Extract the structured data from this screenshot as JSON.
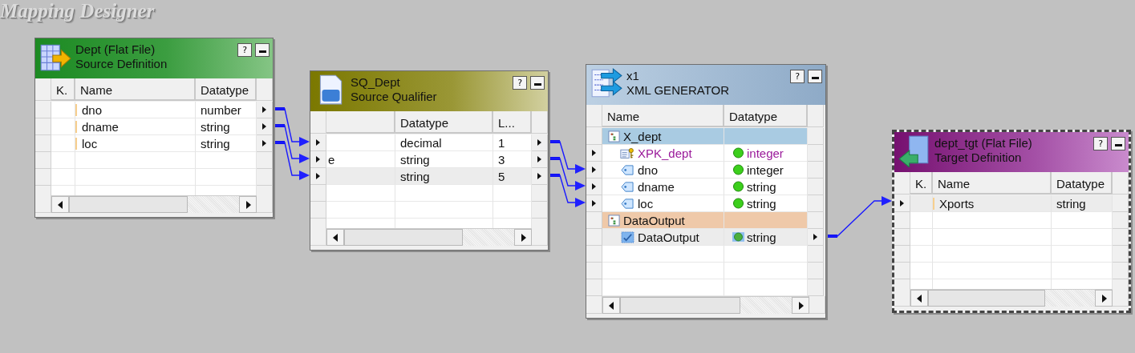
{
  "title": "Mapping Designer",
  "nodes": [
    {
      "kind": "source",
      "name": "Dept (Flat File)",
      "type": "Source Definition",
      "help": "?",
      "selected": false,
      "columns": [
        "K.",
        "Name",
        "Datatype"
      ],
      "rows": [
        {
          "kind": "column",
          "cells": [
            null,
            "dno",
            "number"
          ],
          "in": false,
          "out": true,
          "selected": false
        },
        {
          "kind": "column",
          "cells": [
            null,
            "dname",
            "string"
          ],
          "in": false,
          "out": true,
          "selected": false
        },
        {
          "kind": "column",
          "cells": [
            null,
            "loc",
            "string"
          ],
          "in": false,
          "out": true,
          "selected": false
        }
      ]
    },
    {
      "kind": "qualifier",
      "name": "SQ_Dept",
      "type": "Source Qualifier",
      "help": "?",
      "selected": false,
      "columns": [
        null,
        "Datatype",
        "L..."
      ],
      "rows": [
        {
          "kind": "column",
          "cells": [
            null,
            "decimal",
            "1"
          ],
          "in": true,
          "out": true,
          "selected": false
        },
        {
          "kind": "column",
          "cells": [
            "e",
            "string",
            "3"
          ],
          "in": true,
          "out": true,
          "selected": false
        },
        {
          "kind": "column",
          "cells": [
            null,
            "string",
            "5"
          ],
          "in": true,
          "out": true,
          "selected": true
        }
      ]
    },
    {
      "kind": "xml",
      "name": "x1",
      "type": "XML GENERATOR",
      "help": "?",
      "selected": false,
      "columns": [
        "Name",
        "Datatype"
      ],
      "rows": [
        {
          "kind": "group",
          "cells": [
            "X_dept",
            null
          ],
          "color": "#a9cbe2",
          "in": false,
          "out": false,
          "selected": false
        },
        {
          "kind": "key",
          "cells": [
            "XPK_dept",
            "integer"
          ],
          "in": true,
          "out": false,
          "selected": false
        },
        {
          "kind": "field",
          "cells": [
            "dno",
            "integer"
          ],
          "in": true,
          "out": false,
          "selected": false
        },
        {
          "kind": "field",
          "cells": [
            "dname",
            "string"
          ],
          "in": true,
          "out": false,
          "selected": false
        },
        {
          "kind": "field",
          "cells": [
            "loc",
            "string"
          ],
          "in": true,
          "out": false,
          "selected": false
        },
        {
          "kind": "group",
          "cells": [
            "DataOutput",
            null
          ],
          "color": "#efc9a9",
          "in": false,
          "out": false,
          "selected": false
        },
        {
          "kind": "output",
          "cells": [
            "DataOutput",
            "string"
          ],
          "in": false,
          "out": true,
          "selected": true
        }
      ]
    },
    {
      "kind": "target",
      "name": "dept_tgt (Flat File)",
      "type": "Target Definition",
      "help": "?",
      "selected": true,
      "columns": [
        "K.",
        "Name",
        "Datatype"
      ],
      "rows": [
        {
          "kind": "column",
          "cells": [
            null,
            "Xports",
            "string"
          ],
          "in": true,
          "out": false,
          "selected": true
        }
      ]
    }
  ]
}
